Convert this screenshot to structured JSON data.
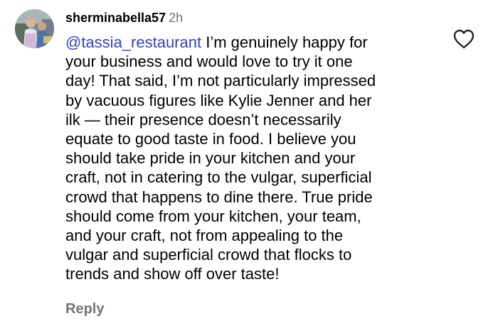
{
  "comment": {
    "username": "sherminabella57",
    "time": "2h",
    "mention": "@tassia_restaurant",
    "line1_rest": " I’m genuinely happy for",
    "lines": [
      "your business and would love to try it one",
      "day! That said, I’m not particularly impressed",
      "by vacuous figures like Kylie Jenner and her",
      "ilk — their presence doesn’t necessarily",
      "equate to good taste in food. I believe you",
      "should take pride in your kitchen and your",
      "craft, not in catering to the vulgar, superficial",
      "crowd that happens to dine there. True pride",
      "should come from your kitchen, your team,",
      "and your craft, not  from appealing to the",
      "vulgar and superficial crowd that flocks to",
      "trends and show off over taste!"
    ],
    "reply_label": "Reply",
    "like_icon": "heart-outline-icon"
  },
  "colors": {
    "mention": "#3143b8",
    "secondary_text": "#737373",
    "text": "#000000",
    "background": "#ffffff"
  }
}
